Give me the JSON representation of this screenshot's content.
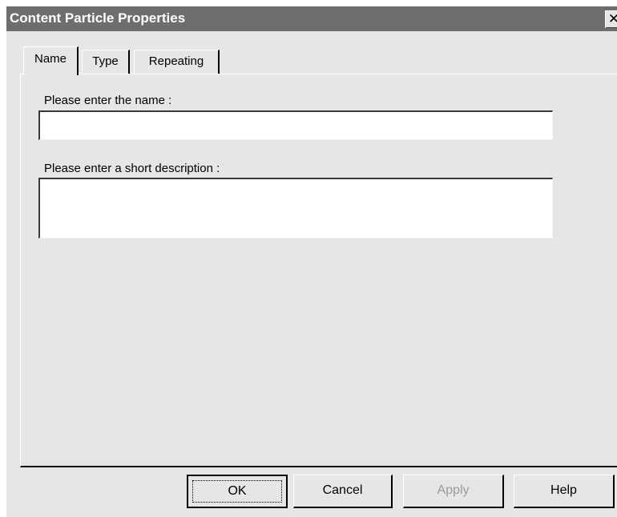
{
  "window": {
    "title": "Content Particle Properties",
    "close_glyph": "✕",
    "close_icon": "close-icon"
  },
  "tabs": [
    {
      "label": "Name",
      "active": true
    },
    {
      "label": "Type",
      "active": false
    },
    {
      "label": "Repeating",
      "active": false
    }
  ],
  "form": {
    "name_label": "Please enter the name :",
    "name_value": "",
    "description_label": "Please enter a short description :",
    "description_value": ""
  },
  "buttons": {
    "ok": "OK",
    "cancel": "Cancel",
    "apply": "Apply",
    "help": "Help"
  },
  "colors": {
    "titlebar": "#6e6e6e",
    "dialog_bg": "#e6e6e6",
    "disabled_text": "#9a9a9a"
  }
}
